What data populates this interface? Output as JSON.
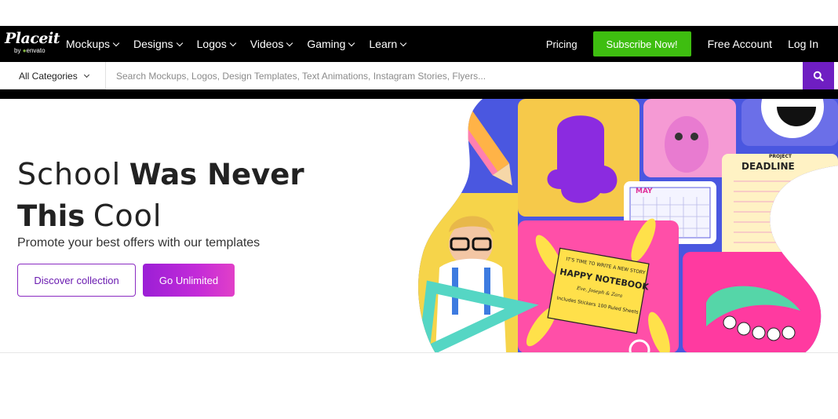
{
  "brand": {
    "name": "Placeit",
    "sub_prefix": "by",
    "sub_name": "envato"
  },
  "nav": {
    "items": [
      {
        "label": "Mockups"
      },
      {
        "label": "Designs"
      },
      {
        "label": "Logos"
      },
      {
        "label": "Videos"
      },
      {
        "label": "Gaming"
      },
      {
        "label": "Learn"
      }
    ],
    "pricing": "Pricing",
    "subscribe": "Subscribe Now!",
    "free_account": "Free Account",
    "login": "Log In"
  },
  "search": {
    "category": "All Categories",
    "placeholder": "Search Mockups, Logos, Design Templates, Text Animations, Instagram Stories, Flyers..."
  },
  "hero": {
    "title_script_1": "School",
    "title_bold_1": "Was Never",
    "title_bold_2": "This",
    "title_script_2": "Cool",
    "subtitle": "Promote your best offers with our templates",
    "btn_discover": "Discover collection",
    "btn_unlimited": "Go Unlimited",
    "art": {
      "calendar_month": "MAY",
      "notebook_top": "IT'S TIME TO WRITE A NEW STORY",
      "notebook_title": "HAPPY NOTEBOOK",
      "notebook_names": "Eve, Joseph & Zara",
      "notebook_tag_1": "Includes Stickers",
      "notebook_tag_2": "100 Ruled Sheets",
      "project_label": "PROJECT",
      "deadline_label": "DEADLINE"
    }
  },
  "colors": {
    "nav_bg": "#000000",
    "subscribe": "#3ebe10",
    "search_btn": "#6f1ec2",
    "accent_purple": "#8a2bc2"
  }
}
